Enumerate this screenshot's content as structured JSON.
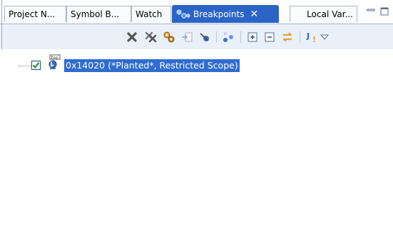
{
  "tabs": [
    {
      "label": "Project N...",
      "active": false
    },
    {
      "label": "Symbol B...",
      "active": false
    },
    {
      "label": "Watch",
      "active": false
    },
    {
      "label": "Breakpoints",
      "active": true,
      "close_glyph": "✕"
    },
    {
      "label": "Local Var...",
      "active": false
    }
  ],
  "view_controls": {
    "minimize_icon": "minimize-icon",
    "maximize_icon": "maximize-icon"
  },
  "toolbar": {
    "buttons": [
      "remove-breakpoint-icon",
      "remove-all-breakpoints-icon",
      "show-breakpoints-supported-by-target-icon",
      "go-to-file-icon",
      "skip-all-breakpoints-icon",
      "link-with-debug-view-icon",
      "expand-all-icon",
      "collapse-all-icon",
      "link-with-view-icon",
      "java-exception-breakpoint-icon",
      "view-menu-icon"
    ]
  },
  "breakpoints": [
    {
      "checked": true,
      "label": "0x14020  (*Planted*, Restricted Scope)",
      "icon": "address-breakpoint-icon",
      "selected": true
    }
  ],
  "colors": {
    "selection": "#2f6ccf",
    "active_tab": "#2b63c6",
    "toolbar_bg": "#eaf0fa"
  }
}
